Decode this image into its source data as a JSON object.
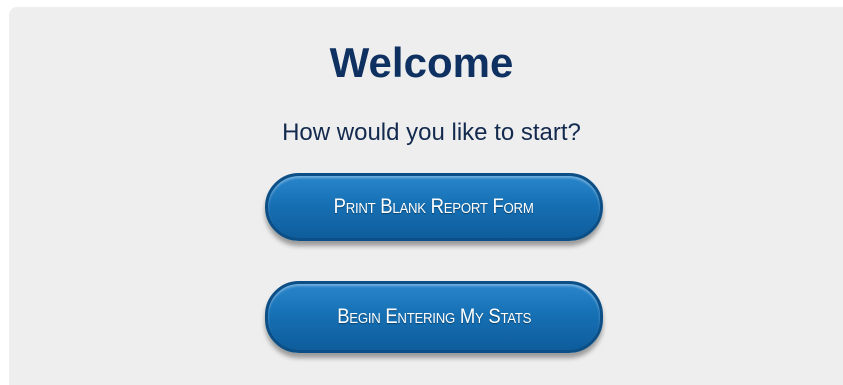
{
  "welcome": {
    "title": "Welcome",
    "subtitle": "How would you like to start?",
    "buttons": {
      "print_blank_report": "Print Blank Report Form",
      "begin_entering_stats": "Begin Entering My Stats"
    }
  },
  "colors": {
    "panel_background": "#eeeeee",
    "title_color": "#0f3161",
    "button_blue": "#1670b4",
    "button_text": "#ffffff"
  }
}
